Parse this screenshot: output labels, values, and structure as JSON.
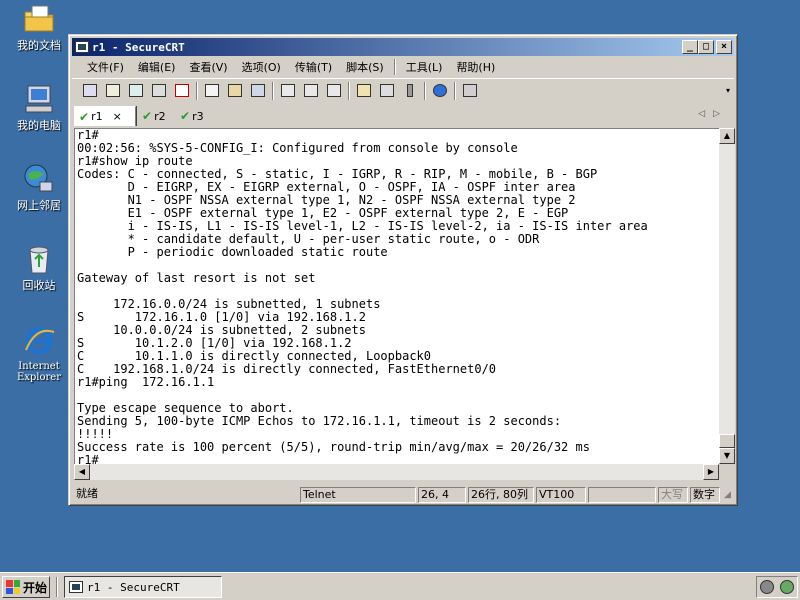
{
  "desktop": {
    "icons": [
      {
        "label": "我的文档"
      },
      {
        "label": "我的电脑"
      },
      {
        "label": "网上邻居"
      },
      {
        "label": "回收站"
      },
      {
        "label": "Internet\nExplorer"
      }
    ]
  },
  "window": {
    "title": "r1 - SecureCRT",
    "minimize": "_",
    "maximize": "□",
    "close": "×"
  },
  "menu": {
    "items": [
      "文件(F)",
      "编辑(E)",
      "查看(V)",
      "选项(O)",
      "传输(T)",
      "脚本(S)",
      "工具(L)",
      "帮助(H)"
    ]
  },
  "toolbar": {
    "icons": [
      "connect-icon",
      "quick-connect-icon",
      "connect-tab-icon",
      "reconnect-icon",
      "disconnect-icon",
      "copy-icon",
      "paste-icon",
      "find-icon",
      "print-icon",
      "print-selection-icon",
      "print-setup-icon",
      "session-options-icon",
      "global-options-icon",
      "keymap-icon",
      "help-icon",
      "screenshot-icon"
    ]
  },
  "tabs": [
    {
      "label": "r1",
      "close": "×",
      "active": true
    },
    {
      "label": "r2",
      "active": false
    },
    {
      "label": "r3",
      "active": false
    }
  ],
  "terminal": {
    "lines": [
      "r1#",
      "00:02:56: %SYS-5-CONFIG_I: Configured from console by console",
      "r1#show ip route",
      "Codes: C - connected, S - static, I - IGRP, R - RIP, M - mobile, B - BGP",
      "       D - EIGRP, EX - EIGRP external, O - OSPF, IA - OSPF inter area",
      "       N1 - OSPF NSSA external type 1, N2 - OSPF NSSA external type 2",
      "       E1 - OSPF external type 1, E2 - OSPF external type 2, E - EGP",
      "       i - IS-IS, L1 - IS-IS level-1, L2 - IS-IS level-2, ia - IS-IS inter area",
      "       * - candidate default, U - per-user static route, o - ODR",
      "       P - periodic downloaded static route",
      "",
      "Gateway of last resort is not set",
      "",
      "     172.16.0.0/24 is subnetted, 1 subnets",
      "S       172.16.1.0 [1/0] via 192.168.1.2",
      "     10.0.0.0/24 is subnetted, 2 subnets",
      "S       10.1.2.0 [1/0] via 192.168.1.2",
      "C       10.1.1.0 is directly connected, Loopback0",
      "C    192.168.1.0/24 is directly connected, FastEthernet0/0",
      "r1#ping  172.16.1.1",
      "",
      "Type escape sequence to abort.",
      "Sending 5, 100-byte ICMP Echos to 172.16.1.1, timeout is 2 seconds:",
      "!!!!!",
      "Success rate is 100 percent (5/5), round-trip min/avg/max = 20/26/32 ms",
      "r1#"
    ]
  },
  "status": {
    "ready": "就绪",
    "protocol": "Telnet",
    "cursor": "26,  4",
    "size": "26行, 80列",
    "emulation": "VT100",
    "caps": "大写",
    "num": "数字"
  },
  "taskbar": {
    "start": "开始",
    "task_title": "r1 - SecureCRT"
  }
}
